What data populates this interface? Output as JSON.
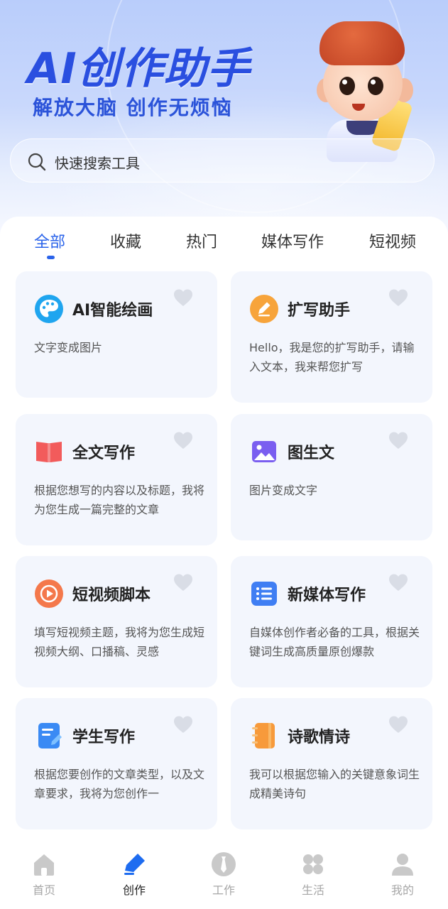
{
  "hero": {
    "title": "AI创作助手",
    "subtitle": "解放大脑 创作无烦恼"
  },
  "search": {
    "placeholder": "快速搜索工具",
    "icon": "search-icon"
  },
  "tabs": [
    {
      "label": "全部",
      "active": true
    },
    {
      "label": "收藏",
      "active": false
    },
    {
      "label": "热门",
      "active": false
    },
    {
      "label": "媒体写作",
      "active": false
    },
    {
      "label": "短视频",
      "active": false
    }
  ],
  "cards": [
    {
      "title": "AI智能绘画",
      "desc": "文字变成图片",
      "icon": "palette-icon",
      "color": "#1fa5ef"
    },
    {
      "title": "扩写助手",
      "desc": "Hello，我是您的扩写助手，请输入文本，我来帮您扩写",
      "icon": "pencil-icon",
      "color": "#f7a43b"
    },
    {
      "title": "全文写作",
      "desc": "根据您想写的内容以及标题，我将为您生成一篇完整的文章",
      "icon": "book-icon",
      "color": "#f25b5b"
    },
    {
      "title": "图生文",
      "desc": "图片变成文字",
      "icon": "image-icon",
      "color": "#7a5ef0"
    },
    {
      "title": "短视频脚本",
      "desc": "填写短视频主题，我将为您生成短视频大纲、口播稿、灵感",
      "icon": "play-icon",
      "color": "#f4784b"
    },
    {
      "title": "新媒体写作",
      "desc": "自媒体创作者必备的工具，根据关键词生成高质量原创爆款",
      "icon": "list-icon",
      "color": "#3f7ef3"
    },
    {
      "title": "学生写作",
      "desc": "根据您要创作的文章类型，以及文章要求，我将为您创作一",
      "icon": "document-icon",
      "color": "#3a8af4"
    },
    {
      "title": "诗歌情诗",
      "desc": "我可以根据您输入的关键意象词生成精美诗句",
      "icon": "notebook-icon",
      "color": "#f79a3b"
    }
  ],
  "nav": [
    {
      "label": "首页",
      "icon": "home-icon",
      "active": false
    },
    {
      "label": "创作",
      "icon": "pen-icon",
      "active": true
    },
    {
      "label": "工作",
      "icon": "tie-icon",
      "active": false
    },
    {
      "label": "生活",
      "icon": "clover-icon",
      "active": false
    },
    {
      "label": "我的",
      "icon": "user-icon",
      "active": false
    }
  ],
  "colors": {
    "accent": "#2a63ea",
    "card_bg": "#f3f6fd",
    "heart": "#d9dde6"
  }
}
